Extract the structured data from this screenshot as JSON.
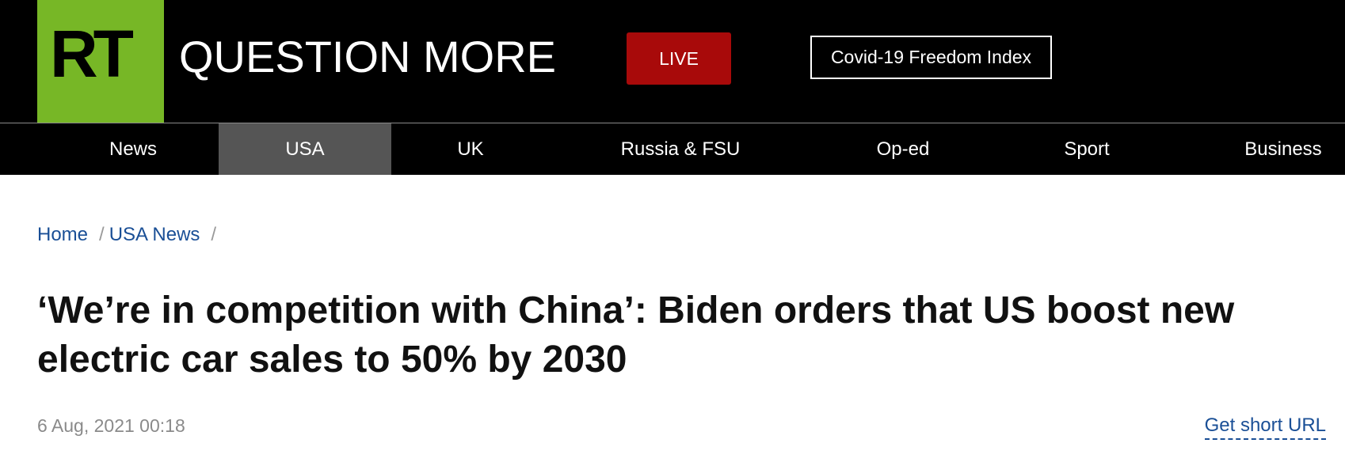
{
  "header": {
    "logo_text": "RT",
    "slogan": "QUESTION MORE",
    "live_label": "LIVE",
    "covid_label": "Covid-19 Freedom Index"
  },
  "nav": {
    "items": [
      {
        "label": "News"
      },
      {
        "label": "USA"
      },
      {
        "label": "UK"
      },
      {
        "label": "Russia & FSU"
      },
      {
        "label": "Op-ed"
      },
      {
        "label": "Sport"
      },
      {
        "label": "Business"
      }
    ],
    "active": "USA"
  },
  "breadcrumb": {
    "items": [
      {
        "label": "Home"
      },
      {
        "label": "USA News"
      }
    ],
    "separator": "/"
  },
  "article": {
    "headline": "‘We’re in competition with China’: Biden orders that US boost new electric car sales to 50% by 2030",
    "date": "6 Aug, 2021 00:18",
    "short_url_label": "Get short URL"
  },
  "colors": {
    "brand_green": "#77b726",
    "live_red": "#a80a0a",
    "link_blue": "#1a4f96",
    "nav_active_bg": "#555555"
  }
}
